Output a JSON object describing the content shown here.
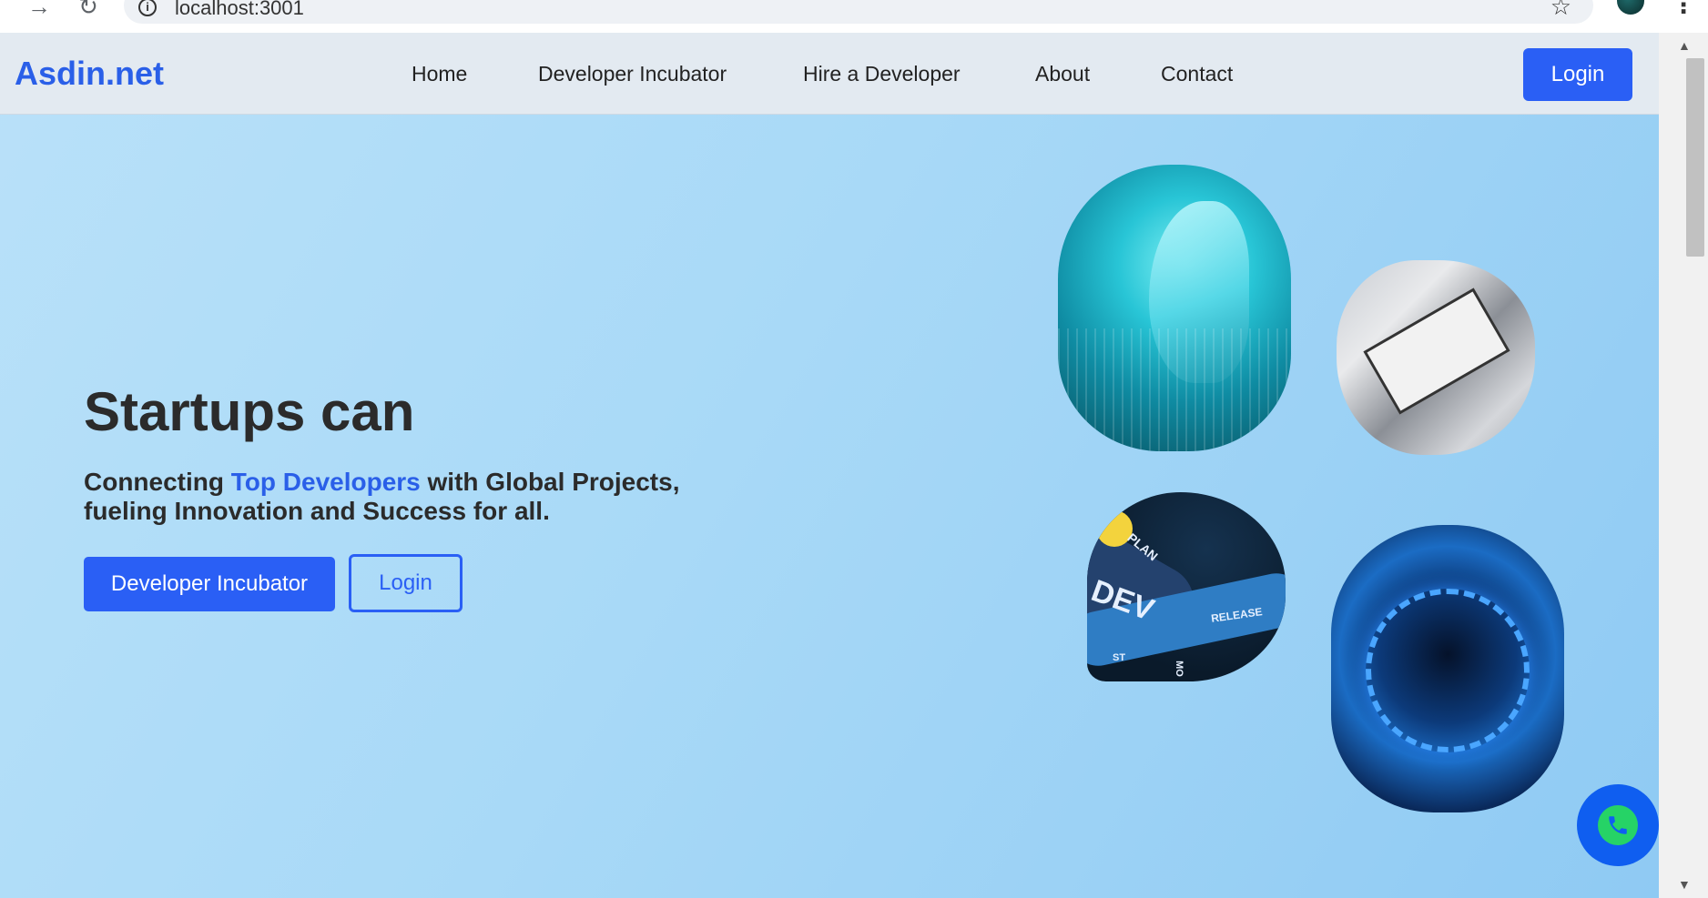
{
  "browser": {
    "url": "localhost:3001",
    "back_icon": "arrow-right-icon",
    "reload_icon": "reload-icon"
  },
  "navbar": {
    "brand": "Asdin.net",
    "links": [
      "Home",
      "Developer Incubator",
      "Hire a Developer",
      "About",
      "Contact"
    ],
    "login_label": "Login"
  },
  "hero": {
    "title": "Startups can",
    "subtitle_prefix": "Connecting ",
    "subtitle_highlight": "Top Developers",
    "subtitle_suffix": " with Global Projects, fueling Innovation and Success for all.",
    "primary_button": "Developer Incubator",
    "secondary_button": "Login"
  },
  "images": {
    "devops_labels": [
      "PLAN",
      "DEV",
      "RELEASE",
      "ST",
      "MO"
    ]
  },
  "colors": {
    "accent": "#2a5ff5",
    "brand": "#2a5fe8",
    "whatsapp_green": "#26d366"
  }
}
